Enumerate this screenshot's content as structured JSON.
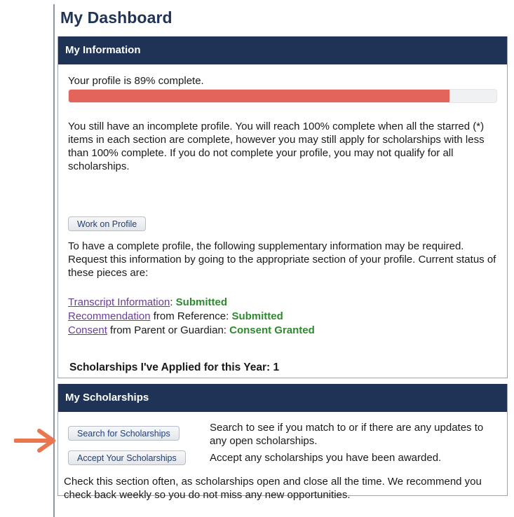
{
  "dashboard": {
    "title": "My Dashboard"
  },
  "my_information": {
    "header": "My Information",
    "profile_status": "Your profile is 89% complete.",
    "progress_percent": 89,
    "incomplete_message": "You still have an incomplete profile. You will reach 100% complete when all the starred (*) items in each section are complete, however you may still apply for scholarships with less than 100% complete. If you do not complete your profile, you may not qualify for all scholarships.",
    "work_button": "Work on Profile",
    "supplementary_message": "To have a complete profile, the following supplementary information may be required. Request this information by going to the appropriate section of your profile. Current status of these pieces are:",
    "items": [
      {
        "link": "Transcript Information",
        "suffix": ": ",
        "status": "Submitted"
      },
      {
        "link": "Recommendation",
        "suffix": " from Reference: ",
        "status": "Submitted"
      },
      {
        "link": "Consent",
        "suffix": " from Parent or Guardian: ",
        "status": "Consent Granted"
      }
    ],
    "applied_label": "Scholarships I've Applied for this Year: 1"
  },
  "my_scholarships": {
    "header": "My Scholarships",
    "search_button": "Search for Scholarships",
    "search_desc": "Search to see if you match to or if there are any updates to any open scholarships.",
    "accept_button": "Accept Your Scholarships",
    "accept_desc": "Accept any scholarships you have been awarded.",
    "note": "Check this section often, as scholarships open and close all the time. We recommend you check back weekly so you do not miss any new opportunities."
  },
  "colors": {
    "header_bg": "#1e3356",
    "progress_fill": "#e2645a",
    "status_green": "#2e8a2e",
    "link_purple": "#6a3d9a",
    "arrow": "#e9764f"
  },
  "icons": {
    "pointer": "arrow-right-icon"
  }
}
